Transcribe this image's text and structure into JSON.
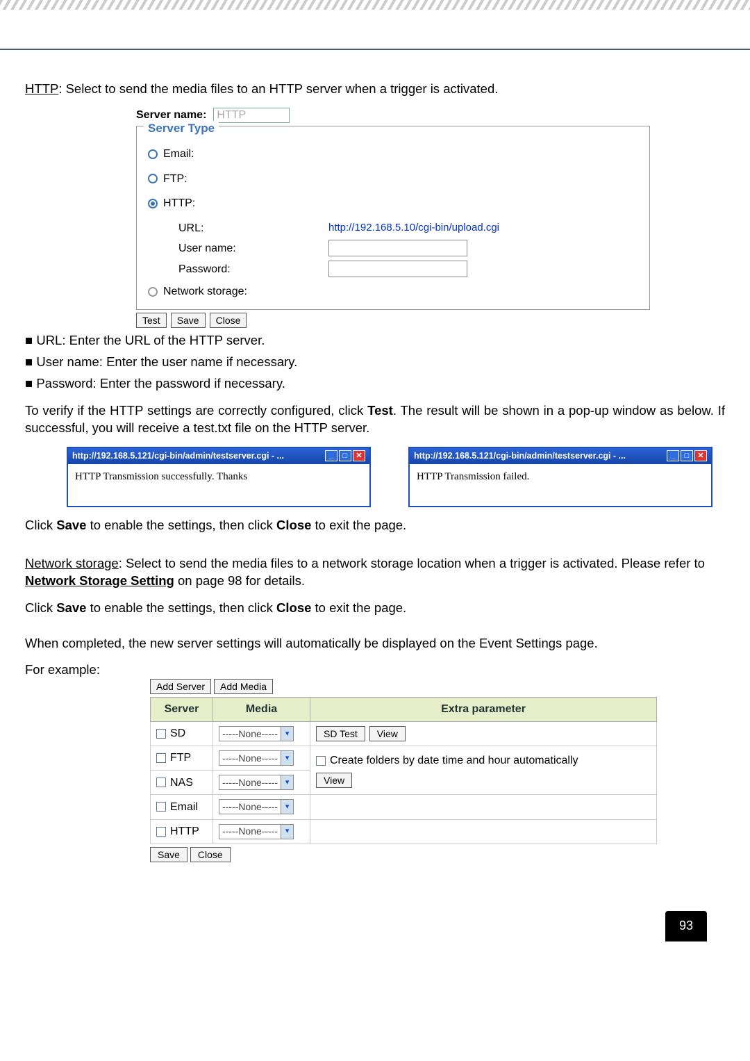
{
  "intro": {
    "http_label": "HTTP",
    "http_text": ": Select to send the media files to an HTTP server when a trigger is activated."
  },
  "server_panel": {
    "server_name_label": "Server name:",
    "server_name_value": "HTTP",
    "legend": "Server Type",
    "email_label": "Email:",
    "ftp_label": "FTP:",
    "http_label": "HTTP:",
    "url_label": "URL:",
    "url_value": "http://192.168.5.10/cgi-bin/upload.cgi",
    "user_label": "User name:",
    "pass_label": "Password:",
    "ns_label": "Network storage:",
    "test_btn": "Test",
    "save_btn": "Save",
    "close_btn": "Close"
  },
  "bullets": {
    "url": "URL: Enter the URL of the HTTP server.",
    "user": "User name: Enter the user name if necessary.",
    "pass": "Password: Enter the password if necessary."
  },
  "test_para": {
    "p1a": "To verify if the HTTP settings are correctly configured, click ",
    "p1b": "Test",
    "p1c": ". The result will be shown in a pop-up window as below. If successful, you will receive a test.txt file on the HTTP server."
  },
  "popup": {
    "title": "http://192.168.5.121/cgi-bin/admin/testserver.cgi - ...",
    "success": "HTTP Transmission successfully. Thanks",
    "fail": "HTTP Transmission failed."
  },
  "after_popup": {
    "p2a": "Click ",
    "p2b": "Save",
    "p2c": " to enable the settings, then click ",
    "p2d": "Close",
    "p2e": " to exit the page."
  },
  "ns_section": {
    "ns_label": "Network storage",
    "ns_text": ": Select to send the media files to a network storage location when a trigger is activated. Please refer to ",
    "ns_link": "Network Storage Setting",
    "ns_text2": " on page 98 for details.",
    "p3a": "Click ",
    "p3b": "Save",
    "p3c": " to enable the settings, then click ",
    "p3d": "Close",
    "p3e": " to exit the page."
  },
  "completed": {
    "p4": "When completed, the new server settings will automatically be displayed on the Event Settings page.",
    "p5": "For example:"
  },
  "ev_table": {
    "add_server_btn": "Add Server",
    "add_media_btn": "Add Media",
    "h1": "Server",
    "h2": "Media",
    "h3": "Extra parameter",
    "none": "-----None-----",
    "sd": "SD",
    "ftp": "FTP",
    "nas": "NAS",
    "email": "Email",
    "http": "HTTP",
    "sd_test": "SD Test",
    "view": "View",
    "auto": "Create folders by date time and hour automatically",
    "save_btn": "Save",
    "close_btn": "Close"
  },
  "page_number": "93"
}
